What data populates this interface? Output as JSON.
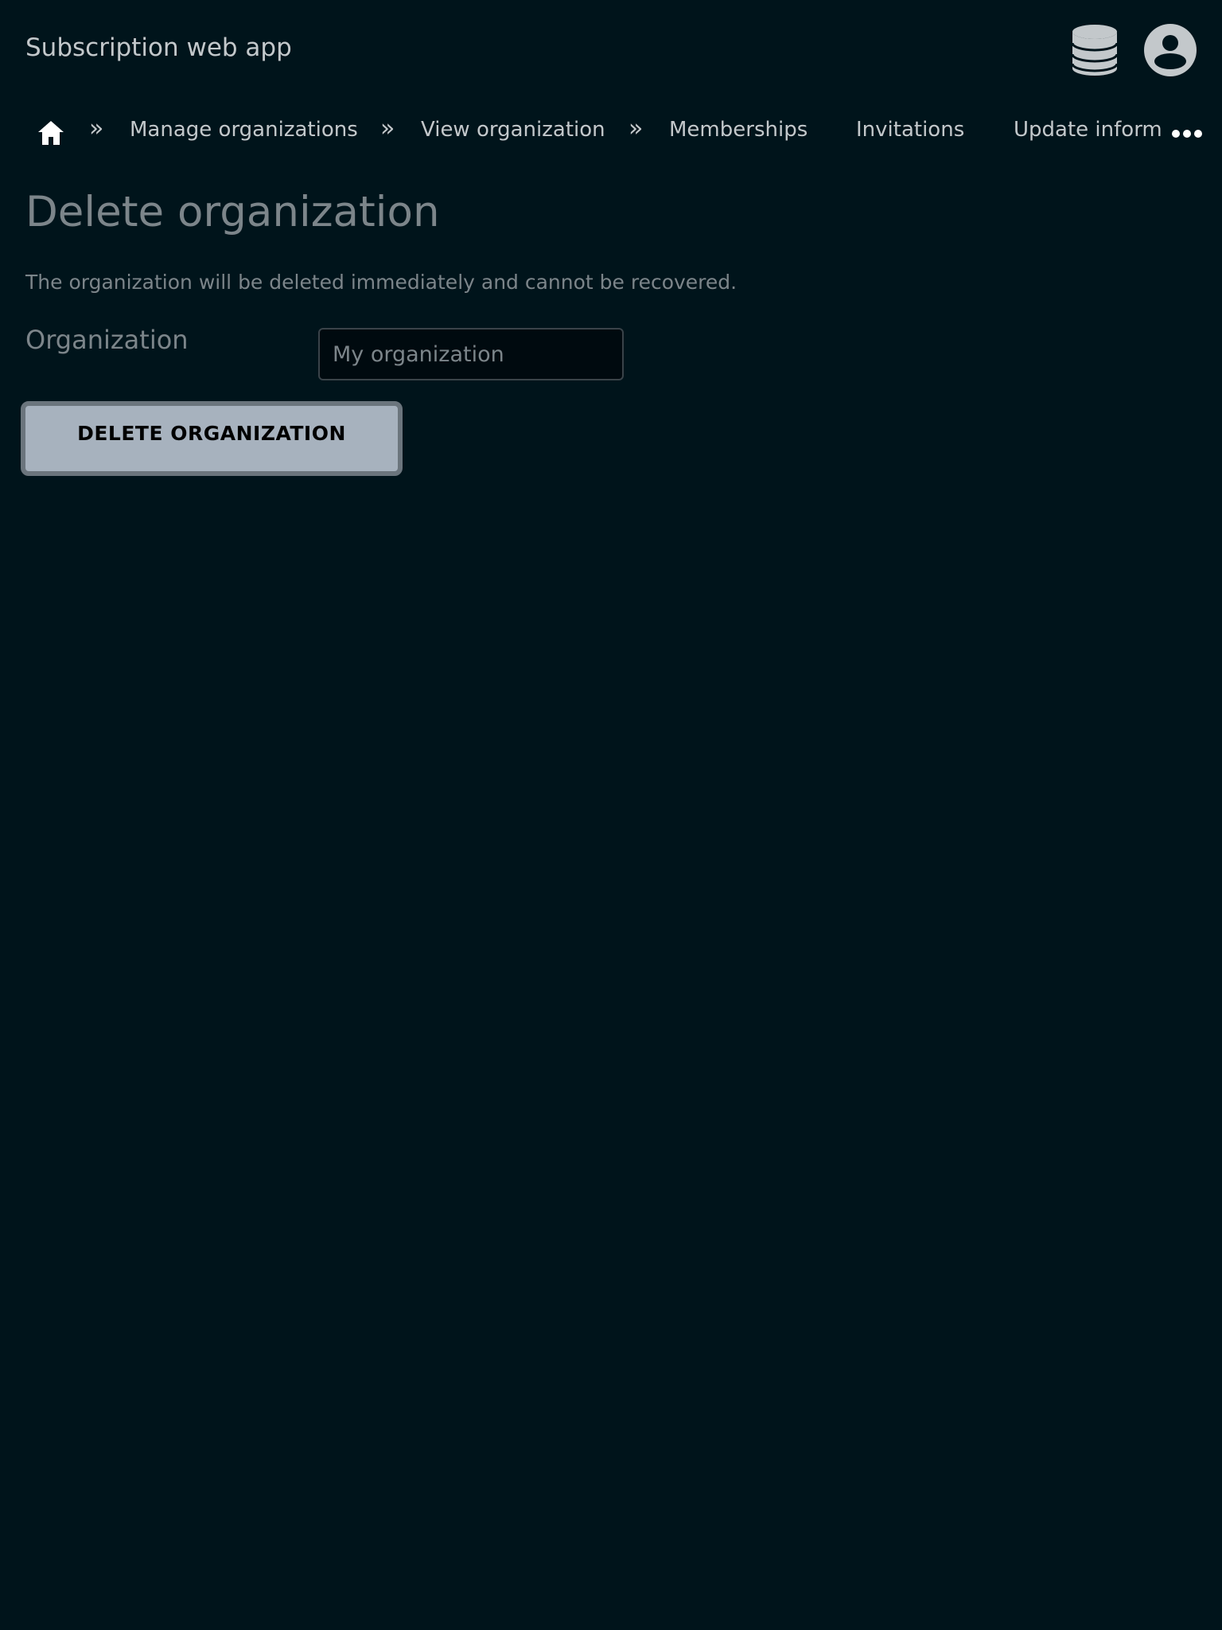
{
  "header": {
    "app_title": "Subscription web app",
    "icons": [
      "database-icon",
      "user-account-icon"
    ]
  },
  "nav": {
    "home_icon": "home-icon",
    "separator": "»",
    "breadcrumbs": [
      {
        "label": "Manage organizations"
      },
      {
        "label": "View organization"
      }
    ],
    "links": [
      {
        "label": "Memberships"
      },
      {
        "label": "Invitations"
      },
      {
        "label": "Update inform"
      }
    ],
    "more_icon": "ellipsis-icon"
  },
  "main": {
    "title": "Delete organization",
    "description": "The organization will be deleted immediately and cannot be recovered.",
    "form": {
      "organization_label": "Organization",
      "organization_placeholder": "My organization",
      "organization_value": ""
    },
    "delete_button_label": "DELETE ORGANIZATION"
  },
  "colors": {
    "background": "#00141b",
    "text_primary": "#c3c8cb",
    "text_muted": "#7c858a",
    "button_bg": "#a7b2be",
    "button_border": "#6b757d",
    "input_bg": "#000a0f"
  }
}
